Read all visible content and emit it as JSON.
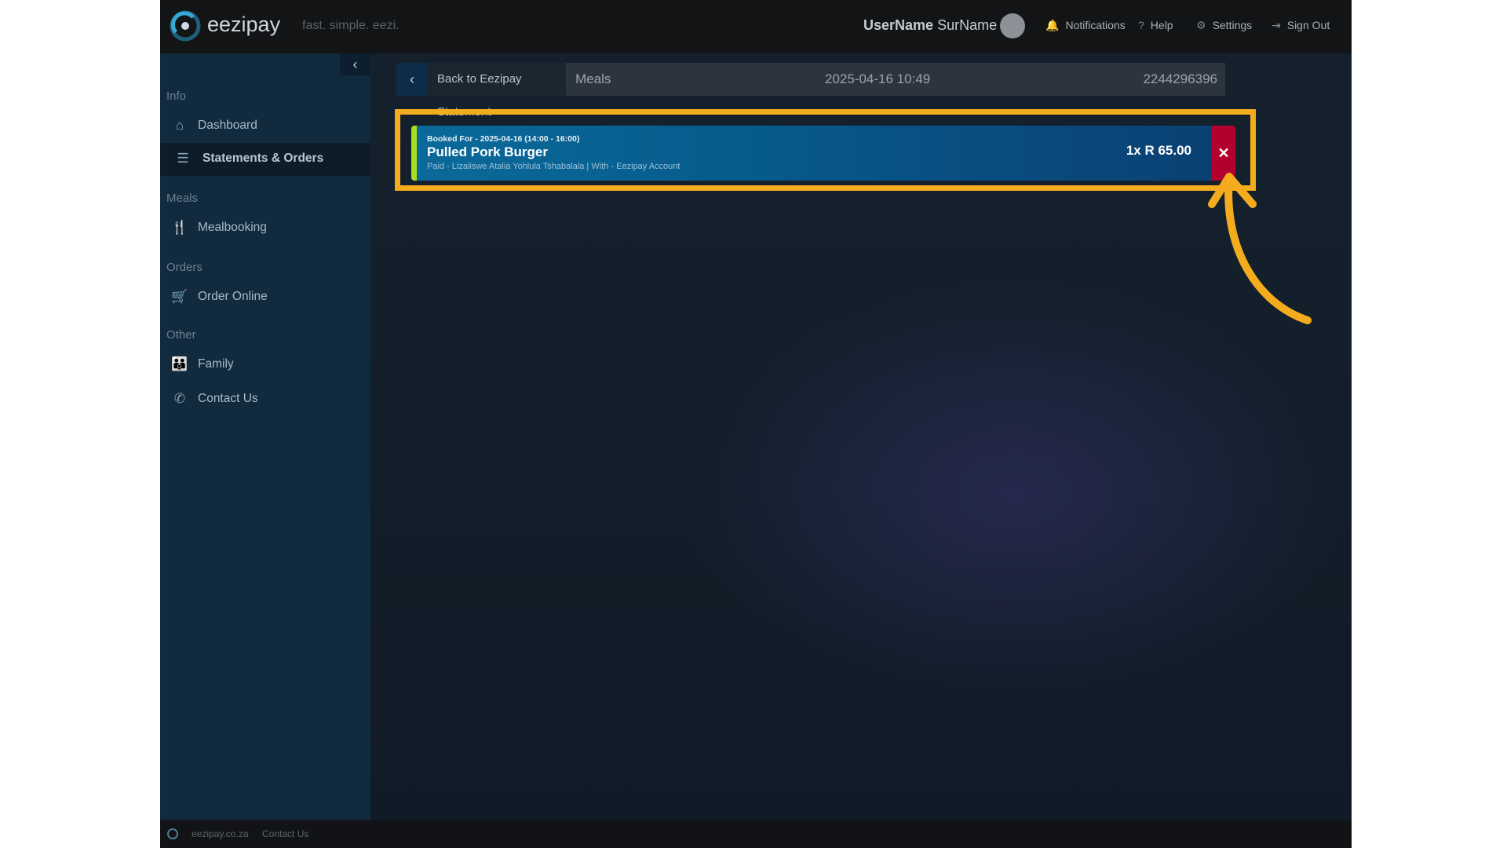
{
  "header": {
    "brand": "eezipay",
    "tagline": "fast. simple. eezi.",
    "user_first": "UserName",
    "user_last": "SurName",
    "nav": [
      {
        "label": "Notifications",
        "icon": "bell-icon"
      },
      {
        "label": "Help",
        "icon": "question-icon"
      },
      {
        "label": "Settings",
        "icon": "gear-icon"
      },
      {
        "label": "Sign Out",
        "icon": "sign-out-icon"
      }
    ]
  },
  "sidebar": {
    "collapse_icon": "chevron-left-icon",
    "sections": [
      {
        "title": "Info",
        "items": [
          {
            "label": "Dashboard",
            "icon": "home-icon"
          },
          {
            "label": "Statements & Orders",
            "icon": "list-icon",
            "active": true
          }
        ]
      },
      {
        "title": "Meals",
        "items": [
          {
            "label": "Mealbooking",
            "icon": "utensils-icon"
          }
        ]
      },
      {
        "title": "Orders",
        "items": [
          {
            "label": "Order Online",
            "icon": "basket-icon"
          }
        ]
      },
      {
        "title": "Other",
        "items": [
          {
            "label": "Family",
            "icon": "family-icon"
          },
          {
            "label": "Contact Us",
            "icon": "phone-icon"
          }
        ]
      }
    ]
  },
  "breadcrumb": {
    "back_label": "Back to Eezipay Statement",
    "category": "Meals",
    "datetime": "2025-04-16 10:49",
    "reference": "2244296396"
  },
  "order": {
    "booked_for": "Booked For - 2025-04-16 (14:00 - 16:00)",
    "title": "Pulled Pork Burger",
    "details": "Paid - Lizaliswe Atalia Yohlula Tshabalala | With - Eezipay Account",
    "price": "1x R 65.00",
    "remove_symbol": "✕"
  },
  "footer": {
    "site": "eezipay.co.za",
    "contact": "Contact Us"
  },
  "colors": {
    "accent_highlight": "#f5ab1e",
    "order_card": "#075b8d",
    "remove_button": "#b3002c",
    "status_strip": "#a8dd22"
  }
}
